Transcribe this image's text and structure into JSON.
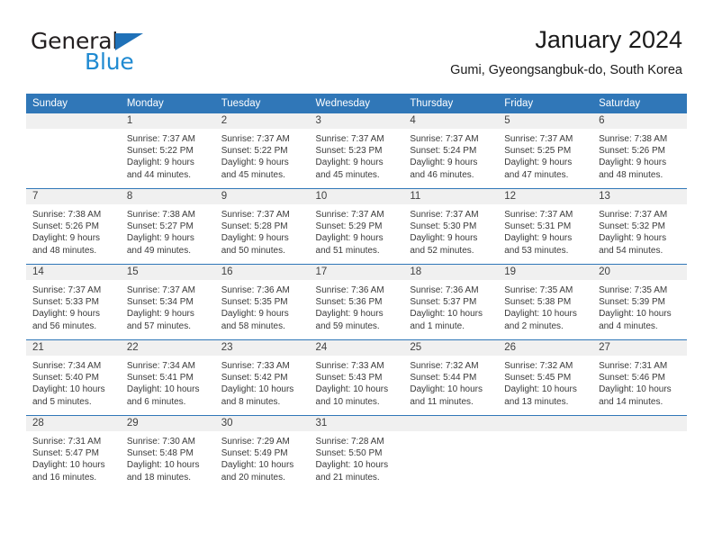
{
  "brand": {
    "name_part1": "General",
    "name_part2": "Blue",
    "triangle_color": "#1f71b8",
    "blue_color": "#1f8ad1"
  },
  "header": {
    "title": "January 2024",
    "subtitle": "Gumi, Gyeongsangbuk-do, South Korea"
  },
  "theme": {
    "header_row_bg": "#3077b8",
    "daynum_bg": "#f0f0f0",
    "row_divider": "#3077b8"
  },
  "weekdays": [
    "Sunday",
    "Monday",
    "Tuesday",
    "Wednesday",
    "Thursday",
    "Friday",
    "Saturday"
  ],
  "weeks": [
    [
      {
        "day": "",
        "blank": true,
        "sunrise": "",
        "sunset": "",
        "daylight": ""
      },
      {
        "day": "1",
        "sunrise": "Sunrise: 7:37 AM",
        "sunset": "Sunset: 5:22 PM",
        "daylight": "Daylight: 9 hours and 44 minutes."
      },
      {
        "day": "2",
        "sunrise": "Sunrise: 7:37 AM",
        "sunset": "Sunset: 5:22 PM",
        "daylight": "Daylight: 9 hours and 45 minutes."
      },
      {
        "day": "3",
        "sunrise": "Sunrise: 7:37 AM",
        "sunset": "Sunset: 5:23 PM",
        "daylight": "Daylight: 9 hours and 45 minutes."
      },
      {
        "day": "4",
        "sunrise": "Sunrise: 7:37 AM",
        "sunset": "Sunset: 5:24 PM",
        "daylight": "Daylight: 9 hours and 46 minutes."
      },
      {
        "day": "5",
        "sunrise": "Sunrise: 7:37 AM",
        "sunset": "Sunset: 5:25 PM",
        "daylight": "Daylight: 9 hours and 47 minutes."
      },
      {
        "day": "6",
        "sunrise": "Sunrise: 7:38 AM",
        "sunset": "Sunset: 5:26 PM",
        "daylight": "Daylight: 9 hours and 48 minutes."
      }
    ],
    [
      {
        "day": "7",
        "sunrise": "Sunrise: 7:38 AM",
        "sunset": "Sunset: 5:26 PM",
        "daylight": "Daylight: 9 hours and 48 minutes."
      },
      {
        "day": "8",
        "sunrise": "Sunrise: 7:38 AM",
        "sunset": "Sunset: 5:27 PM",
        "daylight": "Daylight: 9 hours and 49 minutes."
      },
      {
        "day": "9",
        "sunrise": "Sunrise: 7:37 AM",
        "sunset": "Sunset: 5:28 PM",
        "daylight": "Daylight: 9 hours and 50 minutes."
      },
      {
        "day": "10",
        "sunrise": "Sunrise: 7:37 AM",
        "sunset": "Sunset: 5:29 PM",
        "daylight": "Daylight: 9 hours and 51 minutes."
      },
      {
        "day": "11",
        "sunrise": "Sunrise: 7:37 AM",
        "sunset": "Sunset: 5:30 PM",
        "daylight": "Daylight: 9 hours and 52 minutes."
      },
      {
        "day": "12",
        "sunrise": "Sunrise: 7:37 AM",
        "sunset": "Sunset: 5:31 PM",
        "daylight": "Daylight: 9 hours and 53 minutes."
      },
      {
        "day": "13",
        "sunrise": "Sunrise: 7:37 AM",
        "sunset": "Sunset: 5:32 PM",
        "daylight": "Daylight: 9 hours and 54 minutes."
      }
    ],
    [
      {
        "day": "14",
        "sunrise": "Sunrise: 7:37 AM",
        "sunset": "Sunset: 5:33 PM",
        "daylight": "Daylight: 9 hours and 56 minutes."
      },
      {
        "day": "15",
        "sunrise": "Sunrise: 7:37 AM",
        "sunset": "Sunset: 5:34 PM",
        "daylight": "Daylight: 9 hours and 57 minutes."
      },
      {
        "day": "16",
        "sunrise": "Sunrise: 7:36 AM",
        "sunset": "Sunset: 5:35 PM",
        "daylight": "Daylight: 9 hours and 58 minutes."
      },
      {
        "day": "17",
        "sunrise": "Sunrise: 7:36 AM",
        "sunset": "Sunset: 5:36 PM",
        "daylight": "Daylight: 9 hours and 59 minutes."
      },
      {
        "day": "18",
        "sunrise": "Sunrise: 7:36 AM",
        "sunset": "Sunset: 5:37 PM",
        "daylight": "Daylight: 10 hours and 1 minute."
      },
      {
        "day": "19",
        "sunrise": "Sunrise: 7:35 AM",
        "sunset": "Sunset: 5:38 PM",
        "daylight": "Daylight: 10 hours and 2 minutes."
      },
      {
        "day": "20",
        "sunrise": "Sunrise: 7:35 AM",
        "sunset": "Sunset: 5:39 PM",
        "daylight": "Daylight: 10 hours and 4 minutes."
      }
    ],
    [
      {
        "day": "21",
        "sunrise": "Sunrise: 7:34 AM",
        "sunset": "Sunset: 5:40 PM",
        "daylight": "Daylight: 10 hours and 5 minutes."
      },
      {
        "day": "22",
        "sunrise": "Sunrise: 7:34 AM",
        "sunset": "Sunset: 5:41 PM",
        "daylight": "Daylight: 10 hours and 6 minutes."
      },
      {
        "day": "23",
        "sunrise": "Sunrise: 7:33 AM",
        "sunset": "Sunset: 5:42 PM",
        "daylight": "Daylight: 10 hours and 8 minutes."
      },
      {
        "day": "24",
        "sunrise": "Sunrise: 7:33 AM",
        "sunset": "Sunset: 5:43 PM",
        "daylight": "Daylight: 10 hours and 10 minutes."
      },
      {
        "day": "25",
        "sunrise": "Sunrise: 7:32 AM",
        "sunset": "Sunset: 5:44 PM",
        "daylight": "Daylight: 10 hours and 11 minutes."
      },
      {
        "day": "26",
        "sunrise": "Sunrise: 7:32 AM",
        "sunset": "Sunset: 5:45 PM",
        "daylight": "Daylight: 10 hours and 13 minutes."
      },
      {
        "day": "27",
        "sunrise": "Sunrise: 7:31 AM",
        "sunset": "Sunset: 5:46 PM",
        "daylight": "Daylight: 10 hours and 14 minutes."
      }
    ],
    [
      {
        "day": "28",
        "sunrise": "Sunrise: 7:31 AM",
        "sunset": "Sunset: 5:47 PM",
        "daylight": "Daylight: 10 hours and 16 minutes."
      },
      {
        "day": "29",
        "sunrise": "Sunrise: 7:30 AM",
        "sunset": "Sunset: 5:48 PM",
        "daylight": "Daylight: 10 hours and 18 minutes."
      },
      {
        "day": "30",
        "sunrise": "Sunrise: 7:29 AM",
        "sunset": "Sunset: 5:49 PM",
        "daylight": "Daylight: 10 hours and 20 minutes."
      },
      {
        "day": "31",
        "sunrise": "Sunrise: 7:28 AM",
        "sunset": "Sunset: 5:50 PM",
        "daylight": "Daylight: 10 hours and 21 minutes."
      },
      {
        "day": "",
        "blank": true,
        "sunrise": "",
        "sunset": "",
        "daylight": ""
      },
      {
        "day": "",
        "blank": true,
        "sunrise": "",
        "sunset": "",
        "daylight": ""
      },
      {
        "day": "",
        "blank": true,
        "sunrise": "",
        "sunset": "",
        "daylight": ""
      }
    ]
  ]
}
